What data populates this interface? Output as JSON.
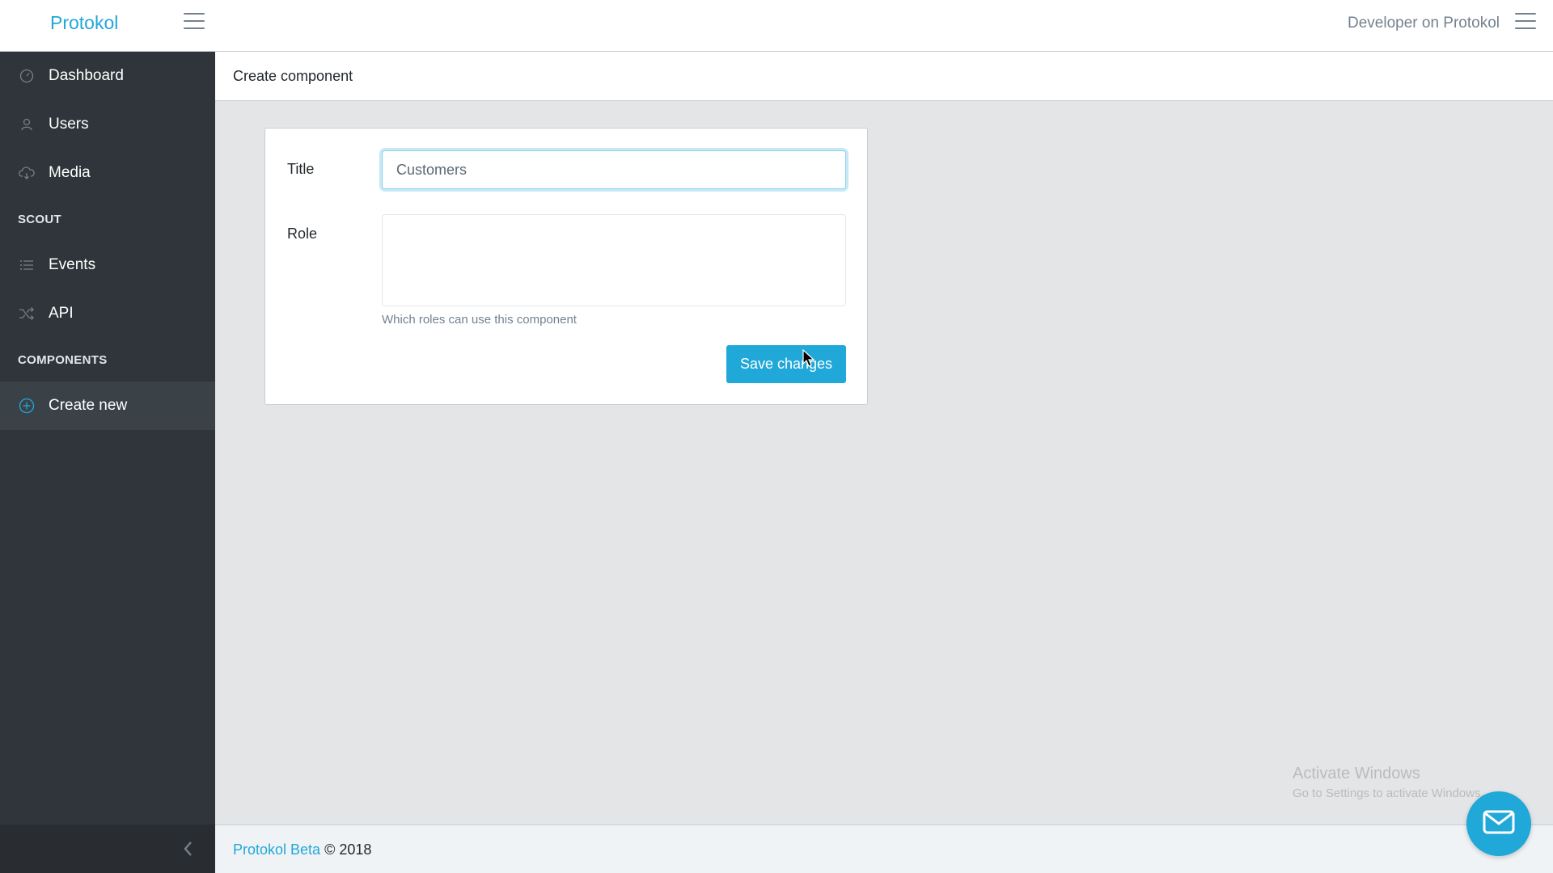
{
  "header": {
    "brand": "Protokol",
    "user_label": "Developer on Protokol"
  },
  "sidebar": {
    "items": [
      {
        "label": "Dashboard",
        "icon": "speedometer-icon"
      },
      {
        "label": "Users",
        "icon": "user-icon"
      },
      {
        "label": "Media",
        "icon": "cloud-download-icon"
      }
    ],
    "section_scout": "SCOUT",
    "scout_items": [
      {
        "label": "Events",
        "icon": "list-icon"
      },
      {
        "label": "API",
        "icon": "shuffle-icon"
      }
    ],
    "section_components": "COMPONENTS",
    "component_items": [
      {
        "label": "Create new",
        "icon": "plus-circle-icon",
        "active": true
      }
    ]
  },
  "breadcrumb": {
    "current": "Create component"
  },
  "form": {
    "title_label": "Title",
    "title_value": "Customers",
    "role_label": "Role",
    "role_value": "",
    "role_help": "Which roles can use this component",
    "save_label": "Save changes"
  },
  "footer": {
    "link_text": "Protokol Beta",
    "copyright": "© 2018"
  },
  "watermark": {
    "line1": "Activate Windows",
    "line2": "Go to Settings to activate Windows."
  },
  "colors": {
    "accent": "#20a8d8",
    "sidebar_bg": "#2f353a",
    "content_bg": "#e4e5e6"
  }
}
